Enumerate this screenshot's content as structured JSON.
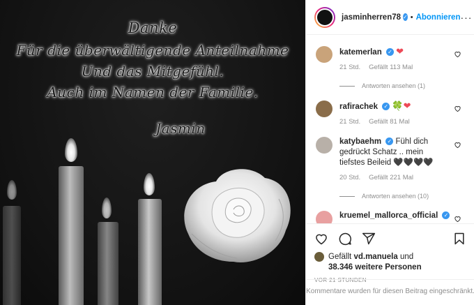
{
  "image": {
    "lines": [
      "Danke",
      "Für die überwältigende Anteilnahme",
      "Und das Mitgefühl.",
      "Auch im Namen der Familie.",
      "Jasmin"
    ]
  },
  "header": {
    "username": "jasminherren78",
    "separator": "•",
    "follow_label": "Abonnieren",
    "more_label": "···"
  },
  "comments": [
    {
      "username": "katemerlan",
      "text": "",
      "emoji": "❤",
      "time": "21 Std.",
      "likes": "Gefällt 113 Mal",
      "replies": "Antworten ansehen (1)",
      "avatar_color": "#c9a37a"
    },
    {
      "username": "rafirachek",
      "text": "",
      "emoji": "🍀❤",
      "time": "21 Std.",
      "likes": "Gefällt 81 Mal",
      "replies": "",
      "avatar_color": "#8a6d4a"
    },
    {
      "username": "katybaehm",
      "text": "Fühl dich gedrückt Schatz .. mein tiefstes Beileid 🖤🖤🖤🖤",
      "emoji": "",
      "time": "20 Std.",
      "likes": "Gefällt 221 Mal",
      "replies": "Antworten ansehen (10)",
      "avatar_color": "#b8b0a8"
    },
    {
      "username": "kruemel_mallorca_official",
      "text": "",
      "emoji": "",
      "time": "",
      "likes": "",
      "replies": "",
      "avatar_color": "#e8a0a0"
    }
  ],
  "actions": {
    "icons": [
      "heart-icon",
      "comment-icon",
      "share-icon",
      "bookmark-icon"
    ]
  },
  "likes": {
    "prefix": "Gefällt",
    "user": "vd.manuela",
    "connector": "und",
    "others": "38.346 weitere Personen"
  },
  "timestamp": "VOR 21 STUNDEN",
  "restricted": "Kommentare wurden für diesen Beitrag eingeschränkt.",
  "colors": {
    "accent": "#0095f6",
    "verified": "#3897f0",
    "heart": "#ed4956",
    "muted": "#8e8e8e"
  }
}
